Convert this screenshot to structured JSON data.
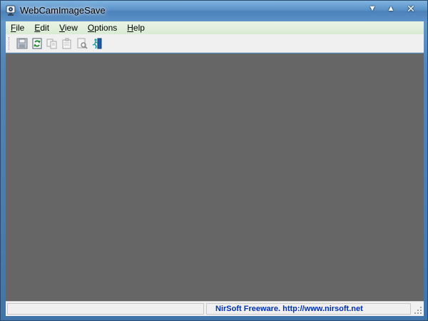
{
  "window": {
    "title": "WebCamImageSave",
    "controls": [
      "▼",
      "▲",
      "✕"
    ]
  },
  "menubar": {
    "items": [
      {
        "access": "F",
        "rest": "ile"
      },
      {
        "access": "E",
        "rest": "dit"
      },
      {
        "access": "V",
        "rest": "iew"
      },
      {
        "access": "O",
        "rest": "ptions"
      },
      {
        "access": "H",
        "rest": "elp"
      }
    ]
  },
  "toolbar": {
    "buttons": [
      "save-icon",
      "refresh-icon",
      "copy-icon",
      "properties-icon",
      "find-icon",
      "exit-icon"
    ]
  },
  "statusbar": {
    "left": "",
    "right": "NirSoft Freeware.  http://www.nirsoft.net"
  },
  "colors": {
    "content_background": "#666666",
    "status_link": "#0030c0"
  }
}
